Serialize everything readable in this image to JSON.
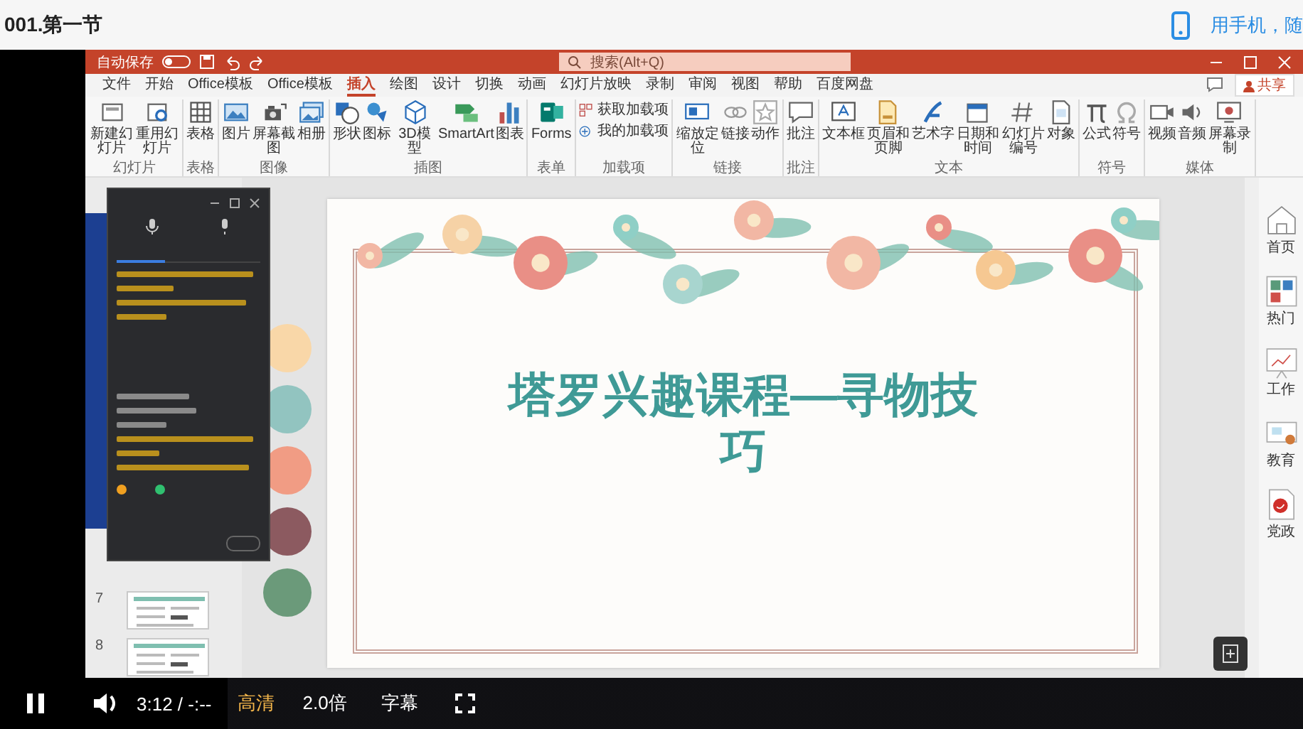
{
  "header": {
    "title": "001.第一节",
    "mobile_link": "用手机，随"
  },
  "ppt": {
    "autosave": {
      "label": "自动保存",
      "on": false
    },
    "search": {
      "placeholder": "搜索(Alt+Q)"
    },
    "share": "共享",
    "tabs": [
      {
        "label": "文件",
        "selected": false
      },
      {
        "label": "开始",
        "selected": false
      },
      {
        "label": "Office模板",
        "selected": false
      },
      {
        "label": "Office模板",
        "selected": false
      },
      {
        "label": "插入",
        "selected": true
      },
      {
        "label": "绘图",
        "selected": false
      },
      {
        "label": "设计",
        "selected": false
      },
      {
        "label": "切换",
        "selected": false
      },
      {
        "label": "动画",
        "selected": false
      },
      {
        "label": "幻灯片放映",
        "selected": false
      },
      {
        "label": "录制",
        "selected": false
      },
      {
        "label": "审阅",
        "selected": false
      },
      {
        "label": "视图",
        "selected": false
      },
      {
        "label": "帮助",
        "selected": false
      },
      {
        "label": "百度网盘",
        "selected": false
      }
    ],
    "ribbon_groups": [
      {
        "label": "幻灯片",
        "buttons": [
          {
            "label": "新建幻灯片",
            "kind": "large"
          },
          {
            "label": "重用幻灯片",
            "kind": "large"
          }
        ]
      },
      {
        "label": "表格",
        "buttons": [
          {
            "label": "表格",
            "kind": "large"
          }
        ]
      },
      {
        "label": "图像",
        "buttons": [
          {
            "label": "图片",
            "kind": "large"
          },
          {
            "label": "屏幕截图",
            "kind": "large"
          },
          {
            "label": "相册",
            "kind": "large"
          }
        ]
      },
      {
        "label": "插图",
        "buttons": [
          {
            "label": "形状",
            "kind": "large"
          },
          {
            "label": "图标",
            "kind": "large"
          },
          {
            "label": "3D模型",
            "kind": "large"
          },
          {
            "label": "SmartArt",
            "kind": "large"
          },
          {
            "label": "图表",
            "kind": "large"
          }
        ]
      },
      {
        "label": "表单",
        "buttons": [
          {
            "label": "Forms",
            "kind": "large"
          }
        ]
      },
      {
        "label": "加载项",
        "buttons": [
          {
            "label": "获取加载项",
            "kind": "small"
          },
          {
            "label": "我的加载项",
            "kind": "small"
          }
        ]
      },
      {
        "label": "链接",
        "buttons": [
          {
            "label": "缩放定位",
            "kind": "large"
          },
          {
            "label": "链接",
            "kind": "large"
          },
          {
            "label": "动作",
            "kind": "large"
          }
        ]
      },
      {
        "label": "批注",
        "buttons": [
          {
            "label": "批注",
            "kind": "large"
          }
        ]
      },
      {
        "label": "文本",
        "buttons": [
          {
            "label": "文本框",
            "kind": "large"
          },
          {
            "label": "页眉和页脚",
            "kind": "large"
          },
          {
            "label": "艺术字",
            "kind": "large"
          },
          {
            "label": "日期和时间",
            "kind": "large"
          },
          {
            "label": "幻灯片编号",
            "kind": "large"
          },
          {
            "label": "对象",
            "kind": "large"
          }
        ]
      },
      {
        "label": "符号",
        "buttons": [
          {
            "label": "公式",
            "kind": "large"
          },
          {
            "label": "符号",
            "kind": "large"
          }
        ]
      },
      {
        "label": "媒体",
        "buttons": [
          {
            "label": "视频",
            "kind": "large"
          },
          {
            "label": "音频",
            "kind": "large"
          },
          {
            "label": "屏幕录制",
            "kind": "large"
          }
        ]
      }
    ],
    "thumbnails": [
      {
        "number": "7"
      },
      {
        "number": "8"
      }
    ],
    "slide": {
      "title": "塔罗兴趣课程—寻物技巧"
    },
    "side_panel": [
      {
        "label": "首页"
      },
      {
        "label": "热门"
      },
      {
        "label": "工作"
      },
      {
        "label": "教育"
      },
      {
        "label": "党政"
      }
    ]
  },
  "player": {
    "playing": true,
    "time": "3:12 / -:--",
    "quality": "高清",
    "speed": "2.0倍",
    "subtitles": "字幕"
  }
}
